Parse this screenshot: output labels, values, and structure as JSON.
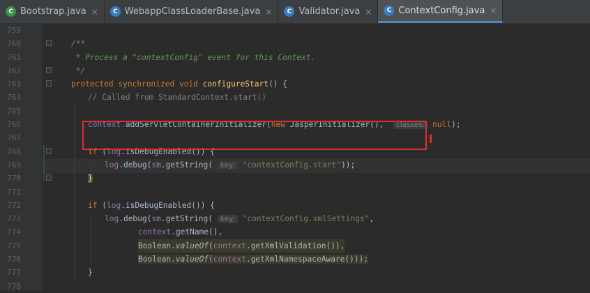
{
  "tabs": [
    {
      "label": "Bootstrap.java",
      "icon": "java-class-icon",
      "active": false
    },
    {
      "label": "WebappClassLoaderBase.java",
      "icon": "java-class-icon",
      "active": false
    },
    {
      "label": "Validator.java",
      "icon": "java-class-icon",
      "active": false
    },
    {
      "label": "ContextConfig.java",
      "icon": "java-class-icon",
      "active": true
    }
  ],
  "tab_close_glyph": "×",
  "line_numbers": [
    "759",
    "760",
    "761",
    "762",
    "763",
    "764",
    "765",
    "766",
    "767",
    "768",
    "769",
    "770",
    "771",
    "772",
    "773",
    "774",
    "775",
    "776",
    "777",
    "778"
  ],
  "code": {
    "l760": "/**",
    "l761": " * Process a \"contextConfig\" event for this Context.",
    "l762": " */",
    "l763_kw1": "protected",
    "l763_kw2": "synchronized",
    "l763_kw3": "void",
    "l763_fn": "configureStart",
    "l763_rest": "() {",
    "l764": "// Called from StandardContext.start()",
    "l766_a": "context.",
    "l766_fn": "addServletContainerInitializer(",
    "l766_new": "new",
    "l766_b": " JasperInitializer(),",
    "l766_hint": "classes:",
    "l766_null": "null",
    "l766_end": ");",
    "l768_if": "if",
    "l768_a": " (",
    "l768_log": "log",
    "l768_b": ".isDebugEnabled()) {",
    "l769_log": "log",
    "l769_a": ".debug(",
    "l769_sm": "sm",
    "l769_b": ".getString(",
    "l769_hint": "key:",
    "l769_str": "\"contextConfig.start\"",
    "l769_end": "));",
    "l770": "}",
    "l772_if": "if",
    "l772_a": " (",
    "l772_log": "log",
    "l772_b": ".isDebugEnabled()) {",
    "l773_log": "log",
    "l773_a": ".debug(",
    "l773_sm": "sm",
    "l773_b": ".getString(",
    "l773_hint": "key:",
    "l773_str": "\"contextConfig.xmlSettings\"",
    "l773_end": ",",
    "l774_ctx": "context",
    "l774_b": ".getName(),",
    "l775_a": "Boolean.",
    "l775_it": "valueOf",
    "l775_b": "(",
    "l775_ctx": "context",
    "l775_c": ".getXmlValidation()),",
    "l776_a": "Boolean.",
    "l776_it": "valueOf",
    "l776_b": "(",
    "l776_ctx": "context",
    "l776_c": ".getXmlNamespaceAware()));",
    "l777": "}"
  }
}
